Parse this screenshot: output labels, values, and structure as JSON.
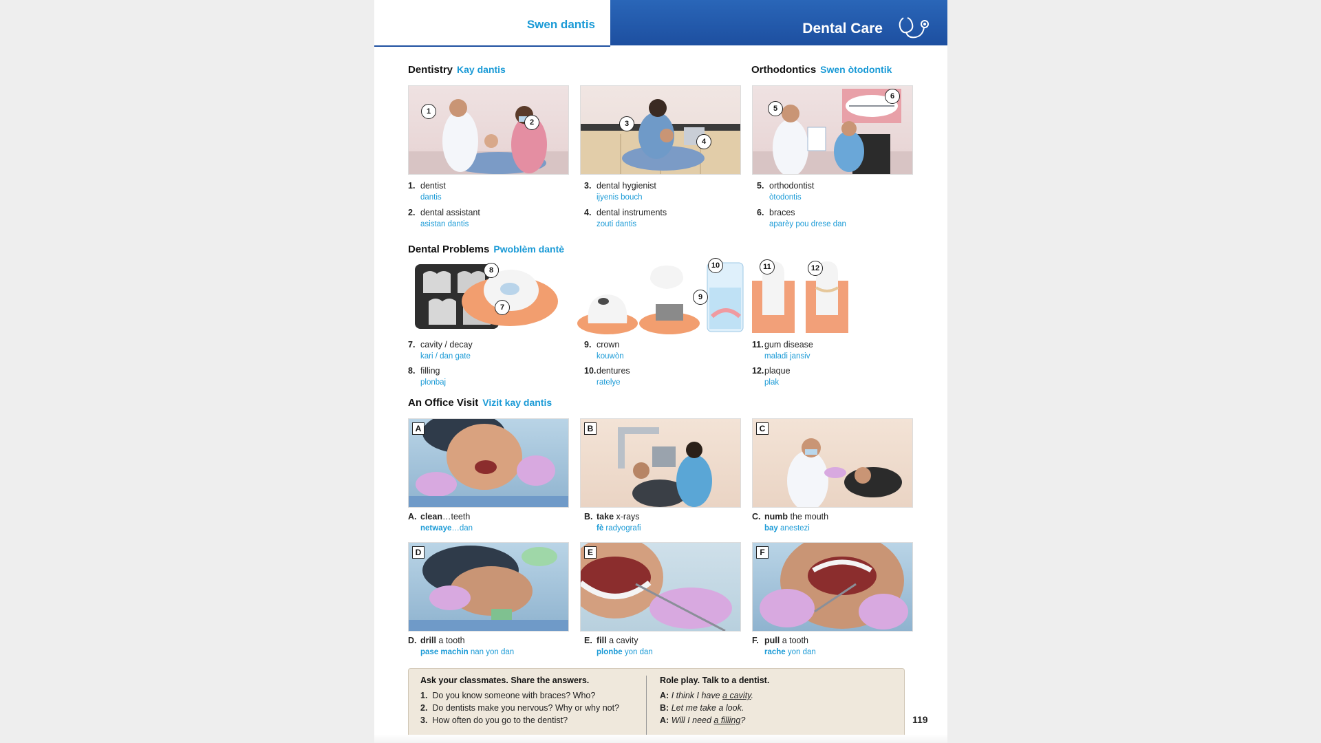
{
  "header": {
    "left_title": "Swen dantis",
    "right_title": "Dental Care",
    "icon": "stethoscope-icon",
    "brand_blue": "#1d4fa0",
    "accent_cyan": "#1a9ad6"
  },
  "sections": {
    "dentistry": {
      "title": "Dentistry",
      "translation": "Kay dantis"
    },
    "orthodontics": {
      "title": "Orthodontics",
      "translation": "Swen òtodontik"
    },
    "problems": {
      "title": "Dental Problems",
      "translation": "Pwoblèm dantè"
    },
    "visit": {
      "title": "An Office Visit",
      "translation": "Vizit kay dantis"
    }
  },
  "vocab": [
    {
      "num": "1.",
      "en": "dentist",
      "kr": "dantis"
    },
    {
      "num": "2.",
      "en": "dental assistant",
      "kr": "asistan dantis"
    },
    {
      "num": "3.",
      "en": "dental hygienist",
      "kr": "ijyenis bouch"
    },
    {
      "num": "4.",
      "en": "dental instruments",
      "kr": "zouti dantis"
    },
    {
      "num": "5.",
      "en": "orthodontist",
      "kr": "òtodontis"
    },
    {
      "num": "6.",
      "en": "braces",
      "kr": "aparèy pou drese dan"
    },
    {
      "num": "7.",
      "en": "cavity / decay",
      "kr": "kari / dan gate"
    },
    {
      "num": "8.",
      "en": "filling",
      "kr": "plonbaj"
    },
    {
      "num": "9.",
      "en": "crown",
      "kr": "kouwòn"
    },
    {
      "num": "10.",
      "en": "dentures",
      "kr": "ratelye"
    },
    {
      "num": "11.",
      "en": "gum disease",
      "kr": "maladi jansiv"
    },
    {
      "num": "12.",
      "en": "plaque",
      "kr": "plak"
    }
  ],
  "callouts": [
    "1",
    "2",
    "3",
    "4",
    "5",
    "6",
    "7",
    "8",
    "9",
    "10",
    "11",
    "12"
  ],
  "verbs": [
    {
      "letter": "A",
      "label": "A.",
      "verb": "clean",
      "rest": "…teeth",
      "kr_bold": "netwaye",
      "kr_rest": "…dan"
    },
    {
      "letter": "B",
      "label": "B.",
      "verb": "take",
      "rest": " x-rays",
      "kr_bold": "fè",
      "kr_rest": " radyografi"
    },
    {
      "letter": "C",
      "label": "C.",
      "verb": "numb",
      "rest": " the mouth",
      "kr_bold": "bay",
      "kr_rest": " anestezi"
    },
    {
      "letter": "D",
      "label": "D.",
      "verb": "drill",
      "rest": " a tooth",
      "kr_bold": "pase machin",
      "kr_rest": " nan yon dan"
    },
    {
      "letter": "E",
      "label": "E.",
      "verb": "fill",
      "rest": " a cavity",
      "kr_bold": "plonbe",
      "kr_rest": " yon dan"
    },
    {
      "letter": "F",
      "label": "F.",
      "verb": "pull",
      "rest": " a tooth",
      "kr_bold": "rache",
      "kr_rest": " yon dan"
    }
  ],
  "activity": {
    "ask_title": "Ask your classmates. Share the answers.",
    "questions": [
      {
        "num": "1.",
        "text": "Do you know someone with braces? Who?"
      },
      {
        "num": "2.",
        "text": "Do dentists make you nervous? Why or why not?"
      },
      {
        "num": "3.",
        "text": "How often do you go to the dentist?"
      }
    ],
    "role_title": "Role play. Talk to a dentist.",
    "dialogue": [
      {
        "speaker": "A:",
        "pre": "I think I have ",
        "u": "a cavity",
        "post": "."
      },
      {
        "speaker": "B:",
        "pre": "Let me take a look.",
        "u": "",
        "post": ""
      },
      {
        "speaker": "A:",
        "pre": "Will I need ",
        "u": "a filling",
        "post": "?"
      }
    ]
  },
  "page_number": "119"
}
